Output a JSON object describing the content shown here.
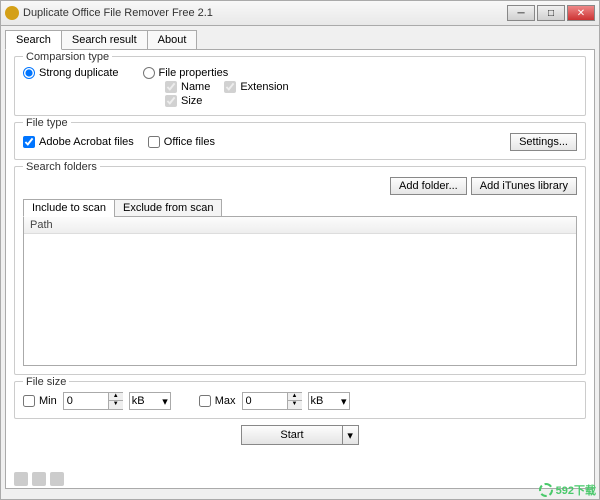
{
  "window": {
    "title": "Duplicate Office File Remover Free 2.1"
  },
  "tabs": {
    "search": "Search",
    "result": "Search result",
    "about": "About"
  },
  "comparison": {
    "legend": "Comparsion type",
    "strong": "Strong duplicate",
    "props": "File properties",
    "name": "Name",
    "extension": "Extension",
    "size": "Size"
  },
  "filetype": {
    "legend": "File type",
    "acrobat": "Adobe Acrobat files",
    "office": "Office files",
    "settings": "Settings..."
  },
  "folders": {
    "legend": "Search folders",
    "add_folder": "Add folder...",
    "add_itunes": "Add iTunes library",
    "include_tab": "Include to scan",
    "exclude_tab": "Exclude from scan",
    "path_header": "Path"
  },
  "filesize": {
    "legend": "File size",
    "min": "Min",
    "max": "Max",
    "min_val": "0",
    "max_val": "0",
    "unit": "kB"
  },
  "start": "Start",
  "watermark": "592下载"
}
